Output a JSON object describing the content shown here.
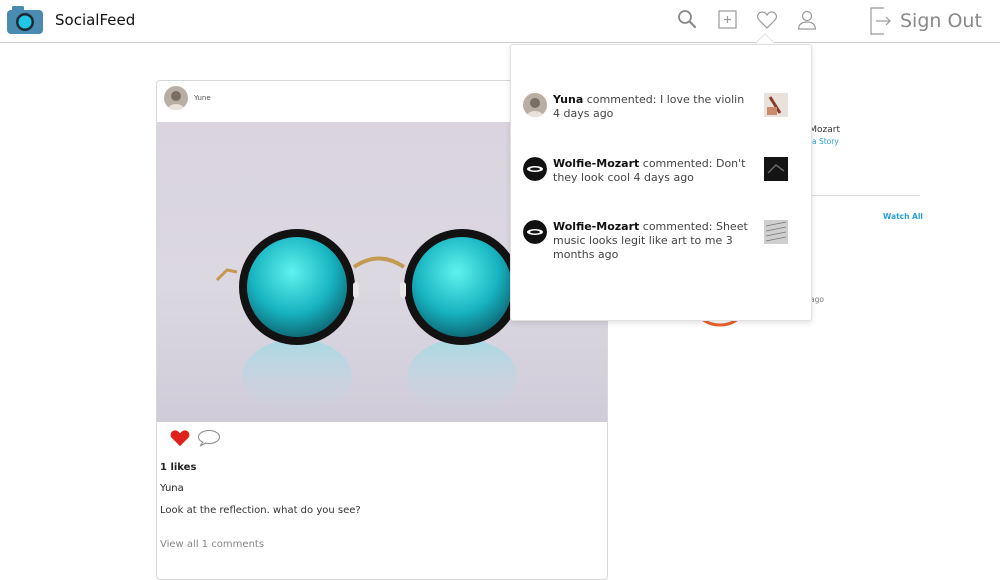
{
  "header": {
    "brand": "SocialFeed",
    "sign_out_label": "Sign Out",
    "icons": [
      "search-icon",
      "add-post-icon",
      "heart-icon",
      "profile-icon",
      "sign-out-icon"
    ]
  },
  "post": {
    "author": "Yune",
    "likes": "1 likes",
    "caption_user": "Yuna",
    "caption": "Look at the reflection. what do you see?",
    "view_comments": "View all 1 comments"
  },
  "sidebar": {
    "user_name": "-Mozart",
    "story_link": "a Story",
    "watch_all": "Watch All",
    "story_time": "ths ago"
  },
  "notifications": [
    {
      "user": "Yuna",
      "text": "commented: I love the violin 4 days ago"
    },
    {
      "user": "Wolfie-Mozart",
      "text": "commented: Don't they look cool 4 days ago"
    },
    {
      "user": "Wolfie-Mozart",
      "text": "commented: Sheet music looks legit like art to me 3 months ago"
    }
  ],
  "colors": {
    "accent": "#2a9fd6",
    "like": "#e0201b",
    "logo": "#4a8bb1",
    "logo_lens": "#1fc6e6"
  }
}
